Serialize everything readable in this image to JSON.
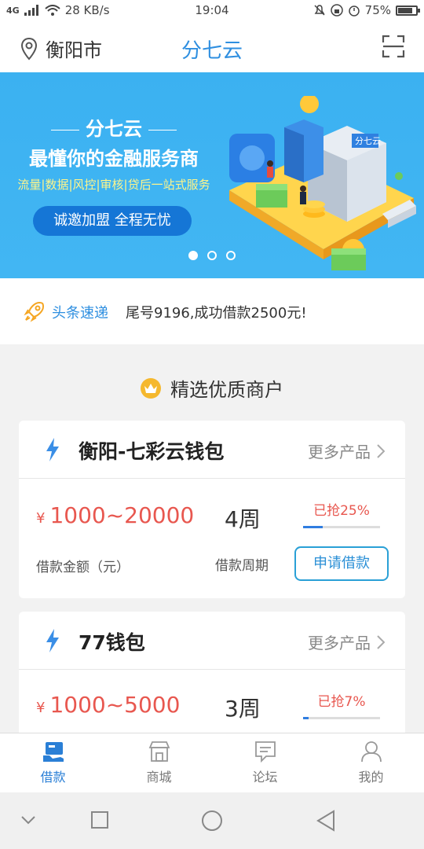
{
  "status_bar": {
    "network": "4G",
    "speed": "28 KB/s",
    "time": "19:04",
    "battery": "75%"
  },
  "header": {
    "city": "衡阳市",
    "title": "分七云",
    "icons": [
      "location-pin-icon",
      "scan-icon"
    ]
  },
  "banner": {
    "brand": "分七云",
    "headline": "最懂你的金融服务商",
    "subline": "流量|数据|风控|审核|贷后一站式服务",
    "cta": "诚邀加盟  全程无忧",
    "slides": 3,
    "active_slide": 1,
    "building_sign": "分七云"
  },
  "news": {
    "tag": "头条速递",
    "message": "尾号9196,成功借款2500元!"
  },
  "section": {
    "title": "精选优质商户"
  },
  "cards": [
    {
      "name": "衡阳-七彩云钱包",
      "more": "更多产品",
      "currency": "¥",
      "amount": "1000~20000",
      "period": "4周",
      "grabbed": "已抢25%",
      "progress": 0.25,
      "amount_label": "借款金额（元）",
      "period_label": "借款周期",
      "apply": "申请借款"
    },
    {
      "name": "77钱包",
      "more": "更多产品",
      "currency": "¥",
      "amount": "1000~5000",
      "period": "3周",
      "grabbed": "已抢7%",
      "progress": 0.07
    }
  ],
  "tabbar": [
    {
      "label": "借款",
      "icon": "loan-icon",
      "active": true
    },
    {
      "label": "商城",
      "icon": "store-icon",
      "active": false
    },
    {
      "label": "论坛",
      "icon": "forum-icon",
      "active": false
    },
    {
      "label": "我的",
      "icon": "profile-icon",
      "active": false
    }
  ],
  "colors": {
    "accent": "#2f8fe0",
    "amount_red": "#e8574f",
    "banner_blue": "#3bb1f1"
  }
}
